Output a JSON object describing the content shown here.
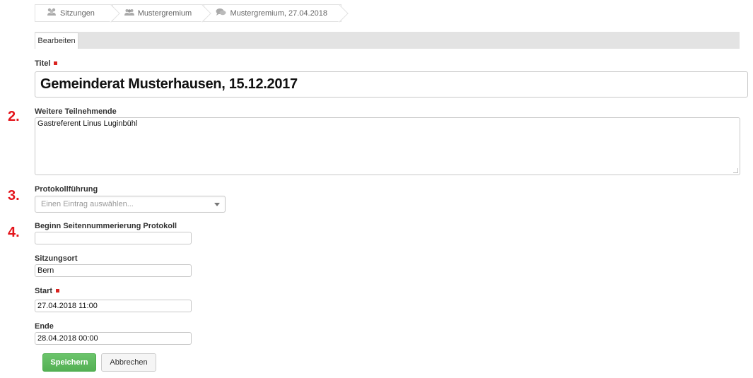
{
  "breadcrumb": {
    "items": [
      {
        "icon": "group-icon",
        "label": "Sitzungen"
      },
      {
        "icon": "people-icon",
        "label": "Mustergremium"
      },
      {
        "icon": "speech-bubbles-icon",
        "label": "Mustergremium, 27.04.2018"
      }
    ]
  },
  "tabs": [
    {
      "label": "Bearbeiten"
    }
  ],
  "form": {
    "title": {
      "label": "Titel",
      "value": "Gemeinderat Musterhausen, 15.12.2017",
      "required": true
    },
    "participants": {
      "label": "Weitere Teilnehmende",
      "value": "Gastreferent Linus Luginbühl"
    },
    "minutes_keeper": {
      "label": "Protokollführung",
      "placeholder": "Einen Eintrag auswählen..."
    },
    "page_numbering": {
      "label": "Beginn Seitennummerierung Protokoll",
      "value": ""
    },
    "location": {
      "label": "Sitzungsort",
      "value": "Bern"
    },
    "start": {
      "label": "Start",
      "value": "27.04.2018 11:00",
      "required": true
    },
    "end": {
      "label": "Ende",
      "value": "28.04.2018 00:00"
    }
  },
  "buttons": {
    "save": "Speichern",
    "cancel": "Abbrechen"
  },
  "markers": [
    "2.",
    "3.",
    "4."
  ],
  "colors": {
    "required": "#d9231f",
    "marker": "#e4141b",
    "save": "#5cb85c"
  }
}
